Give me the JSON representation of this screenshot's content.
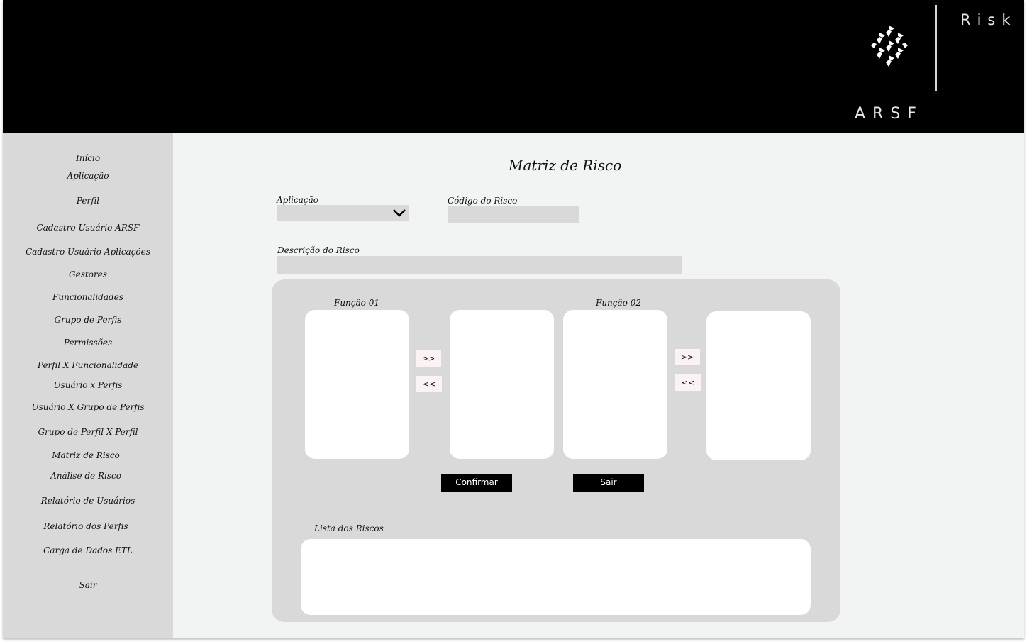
{
  "header": {
    "brand_right": "Risk",
    "brand_bottom": "ARSF",
    "logo_icon": "arsf-hexagon-logo-icon"
  },
  "sidebar": {
    "items": [
      {
        "label": "Início"
      },
      {
        "label": "Aplicação"
      },
      {
        "label": "Perfil"
      },
      {
        "label": "Cadastro Usuário ARSF"
      },
      {
        "label": "Cadastro Usuário Aplicações"
      },
      {
        "label": "Gestores"
      },
      {
        "label": "Funcionalidades"
      },
      {
        "label": "Grupo de Perfis"
      },
      {
        "label": "Permissões"
      },
      {
        "label": "Perfil X Funcionalidade"
      },
      {
        "label": "Usuário x Perfis"
      },
      {
        "label": "Usuário X Grupo de Perfis"
      },
      {
        "label": "Grupo de Perfil X Perfil"
      },
      {
        "label": "Matriz de Risco"
      },
      {
        "label": "Análise de Risco"
      },
      {
        "label": "Relatório de Usuários"
      },
      {
        "label": "Relatório dos Perfis"
      },
      {
        "label": "Carga de Dados ETL"
      },
      {
        "label": "Sair"
      }
    ]
  },
  "main": {
    "title": "Matriz de Risco",
    "form": {
      "aplicacao_label": "Aplicação",
      "aplicacao_value": "",
      "codigo_label": "Código do Risco",
      "codigo_value": "",
      "descricao_label": "Descrição do Risco",
      "descricao_value": ""
    },
    "matrix": {
      "funcao1_label": "Função 01",
      "funcao2_label": "Função 02",
      "move_right_label": ">>",
      "move_left_label": "<<",
      "confirm_label": "Confirmar",
      "exit_label": "Sair",
      "risk_list_label": "Lista dos Riscos"
    }
  },
  "colors": {
    "header_bg": "#000000",
    "sidebar_bg": "#d9d9d9",
    "main_bg": "#f2f4f3",
    "panel_bg": "#d9d9d9",
    "button_bg": "#000000"
  }
}
